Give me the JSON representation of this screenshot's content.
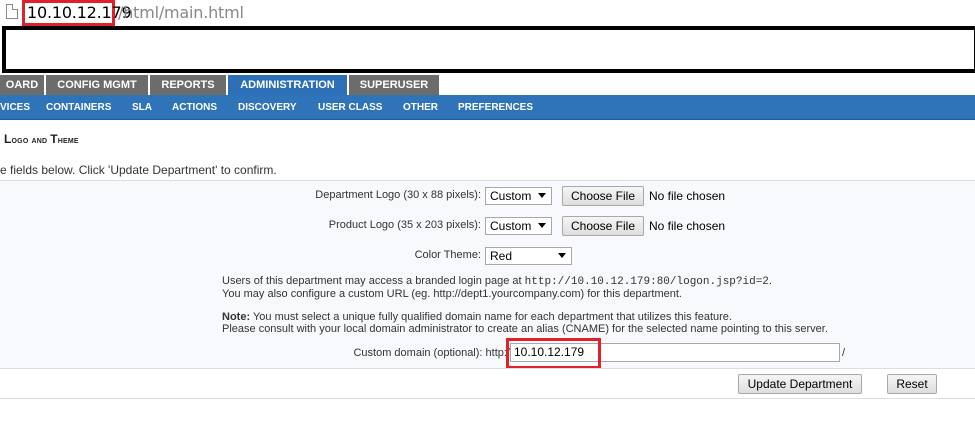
{
  "url": {
    "host": "10.10.12.179",
    "path": "/html/main.html"
  },
  "main_tabs": [
    "OARD",
    "CONFIG MGMT",
    "REPORTS",
    "ADMINISTRATION",
    "SUPERUSER"
  ],
  "sub_tabs": [
    "VICES",
    "CONTAINERS",
    "SLA",
    "ACTIONS",
    "DISCOVERY",
    "USER CLASS",
    "OTHER",
    "PREFERENCES"
  ],
  "section": {
    "title_prefix": "L",
    "title_rest": "ogo and ",
    "title_prefix2": "T",
    "title_rest2": "heme"
  },
  "instructions": "e fields below. Click 'Update Department' to confirm.",
  "form": {
    "dept_logo_label": "Department Logo (30 x 88 pixels):",
    "dept_logo_value": "Custom",
    "product_logo_label": "Product Logo (35 x 203 pixels):",
    "product_logo_value": "Custom",
    "choose_file": "Choose File",
    "no_file": "No file chosen",
    "color_theme_label": "Color Theme:",
    "color_theme_value": "Red",
    "info_line1_a": "Users of this department may access a branded login page at ",
    "info_line1_url": "http://10.10.12.179:80/logon.jsp?id=2",
    "info_line1_end": ".",
    "info_line2": "You may also configure a custom URL (eg. http://dept1.yourcompany.com) for this department.",
    "note_label": "Note:",
    "note_line1": " You must select a unique fully qualified domain name for each department that utilizes this feature.",
    "note_line2": "Please consult with your local domain administrator to create an alias (CNAME) for the selected name pointing to this server.",
    "custom_domain_label": "Custom domain (optional): http:/",
    "custom_domain_value": "10.10.12.179",
    "custom_domain_suffix": "/"
  },
  "buttons": {
    "update": "Update Department",
    "reset": "Reset"
  }
}
